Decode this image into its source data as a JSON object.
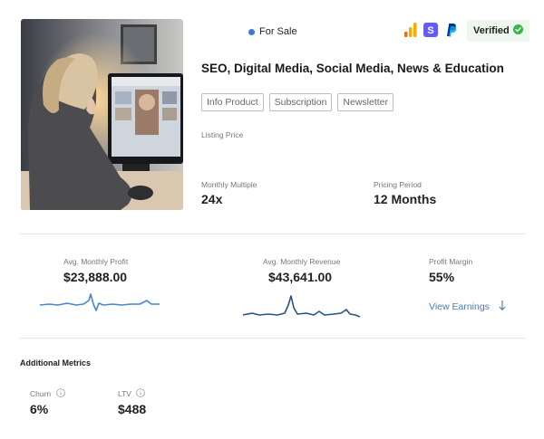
{
  "listing": {
    "status": "For Sale",
    "verified_label": "Verified",
    "title": "SEO, Digital Media, Social Media, News & Education",
    "tags": [
      "Info Product",
      "Subscription",
      "Newsletter"
    ],
    "listing_price_label": "Listing Price",
    "monthly_multiple_label": "Monthly Multiple",
    "monthly_multiple_value": "24x",
    "pricing_period_label": "Pricing Period",
    "pricing_period_value": "12 Months"
  },
  "integrations": [
    {
      "name": "analytics-icon",
      "color": "#f4a021"
    },
    {
      "name": "stripe-icon",
      "color": "#635bff"
    },
    {
      "name": "paypal-icon",
      "color": "#003087"
    }
  ],
  "metrics": {
    "avg_monthly_profit_label": "Avg. Monthly Profit",
    "avg_monthly_profit_value": "$23,888.00",
    "avg_monthly_revenue_label": "Avg. Monthly Revenue",
    "avg_monthly_revenue_value": "$43,641.00",
    "profit_margin_label": "Profit Margin",
    "profit_margin_value": "55%",
    "view_earnings_label": "View Earnings"
  },
  "additional": {
    "title": "Additional Metrics",
    "churn_label": "Churn",
    "churn_value": "6%",
    "ltv_label": "LTV",
    "ltv_value": "$488"
  },
  "colors": {
    "status_dot": "#3e7ad0",
    "profit_line": "#4a86c8",
    "revenue_line": "#2a5283",
    "link": "#4a79b0",
    "verified_bg": "#eef7ee",
    "verified_check": "#35b64a"
  }
}
